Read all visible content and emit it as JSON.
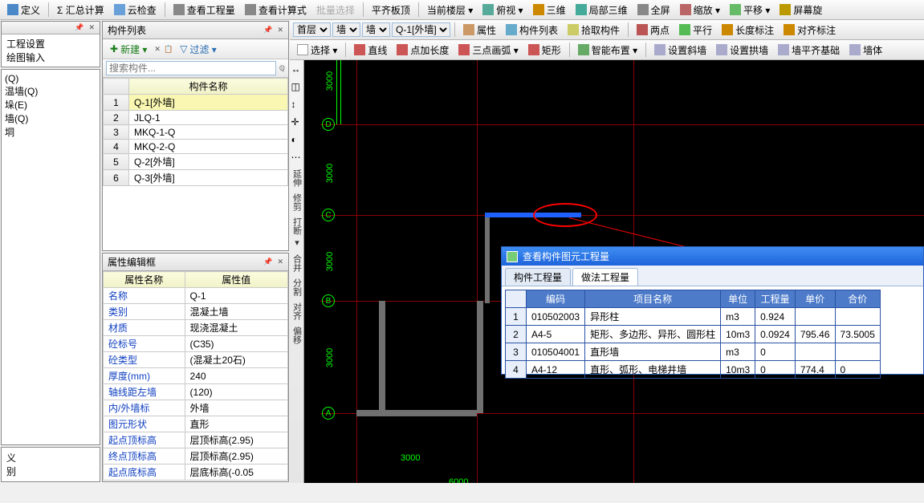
{
  "top_toolbar": [
    {
      "label": "定义"
    },
    {
      "label": "Σ 汇总计算",
      "sigma": true
    },
    {
      "label": "云检查"
    },
    {
      "label": "查看工程量"
    },
    {
      "label": "查看计算式"
    },
    {
      "label": "批量选择"
    },
    {
      "label": "平齐板顶"
    },
    {
      "label": "当前楼层 ▾"
    },
    {
      "label": "俯视 ▾"
    },
    {
      "label": "三维"
    },
    {
      "label": "局部三维"
    },
    {
      "label": "全屏"
    },
    {
      "label": "缩放 ▾"
    },
    {
      "label": "平移 ▾"
    },
    {
      "label": "屏幕旋"
    }
  ],
  "sub_toolbar_row1": {
    "floor": "首层",
    "type1": "墙",
    "type2": "墙",
    "component": "Q-1[外墙]",
    "buttons": [
      "属性",
      "构件列表",
      "拾取构件",
      "两点",
      "平行",
      "长度标注",
      "对齐标注"
    ]
  },
  "sub_toolbar_row2": {
    "buttons": [
      "选择 ▾",
      "直线",
      "点加长度",
      "三点画弧 ▾",
      "矩形",
      "智能布置 ▾",
      "设置斜墙",
      "设置拱墙",
      "墙平齐基础",
      "墙体"
    ]
  },
  "left_panel": {
    "title": "工程设置",
    "subtitle": "绘图输入",
    "tree": [
      "(Q)",
      "温墙(Q)",
      "垛(E)",
      "墙(Q)",
      "垌"
    ]
  },
  "component_list": {
    "title": "构件列表",
    "new_label": "新建 ▾",
    "filter_label": "过滤 ▾",
    "search_ph": "搜索构件...",
    "header": "构件名称",
    "rows": [
      "Q-1[外墙]",
      "JLQ-1",
      "MKQ-1-Q",
      "MKQ-2-Q",
      "Q-2[外墙]",
      "Q-3[外墙]"
    ]
  },
  "property_panel": {
    "title": "属性编辑框",
    "colA": "属性名称",
    "colB": "属性值",
    "rows": [
      {
        "name": "名称",
        "val": "Q-1"
      },
      {
        "name": "类别",
        "val": "混凝土墙"
      },
      {
        "name": "材质",
        "val": "现浇混凝土"
      },
      {
        "name": "砼标号",
        "val": "(C35)"
      },
      {
        "name": "砼类型",
        "val": "(混凝土20石)"
      },
      {
        "name": "厚度(mm)",
        "val": "240"
      },
      {
        "name": "轴线距左墙",
        "val": "(120)"
      },
      {
        "name": "内/外墙标",
        "val": "外墙"
      },
      {
        "name": "图元形状",
        "val": "直形"
      },
      {
        "name": "起点顶标高",
        "val": "层顶标高(2.95)"
      },
      {
        "name": "终点顶标高",
        "val": "层顶标高(2.95)"
      },
      {
        "name": "起点底标高",
        "val": "层底标高(-0.05"
      }
    ]
  },
  "vtoolbar": [
    "延伸",
    "修剪",
    "打断 ▾",
    "合并",
    "分割",
    "对齐",
    "偏移"
  ],
  "dims": [
    "3000",
    "3000",
    "3000",
    "3000",
    "6000",
    "3000"
  ],
  "axes": [
    "D",
    "C",
    "B",
    "A"
  ],
  "popup": {
    "title": "查看构件图元工程量",
    "tab1": "构件工程量",
    "tab2": "做法工程量",
    "headers": [
      "",
      "编码",
      "项目名称",
      "单位",
      "工程量",
      "单价",
      "合价"
    ],
    "rows": [
      [
        "1",
        "010502003",
        "异形柱",
        "m3",
        "0.924",
        "",
        ""
      ],
      [
        "2",
        "A4-5",
        "矩形、多边形、异形、圆形柱",
        "10m3",
        "0.0924",
        "795.46",
        "73.5005"
      ],
      [
        "3",
        "010504001",
        "直形墙",
        "m3",
        "0",
        "",
        ""
      ],
      [
        "4",
        "A4-12",
        "直形、弧形、电梯井墙",
        "10m3",
        "0",
        "774.4",
        "0"
      ]
    ]
  }
}
